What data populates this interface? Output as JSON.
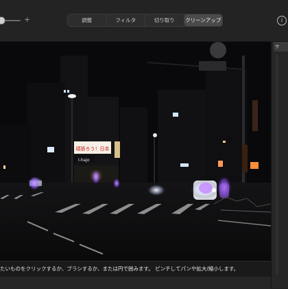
{
  "toolbar": {
    "zoom_plus": "+",
    "tabs": [
      {
        "label": "調整",
        "active": false
      },
      {
        "label": "フィルタ",
        "active": false
      },
      {
        "label": "切り取り",
        "active": false
      },
      {
        "label": "クリーンアップ",
        "active": true
      }
    ],
    "info_label": "i"
  },
  "side_panel": {
    "tab_label": "サ"
  },
  "photo": {
    "sign_text": "頑張ろう！日本",
    "store_sign": "l-hajo"
  },
  "hint": {
    "text": "たいものをクリックするか、ブラシするか、または円で囲みます。 ピンチしてパンや拡大/縮小します。"
  },
  "colors": {
    "accent_selected": "#4a4a4a",
    "mask_highlight": "#a06cff",
    "background": "#1e1e1e"
  }
}
